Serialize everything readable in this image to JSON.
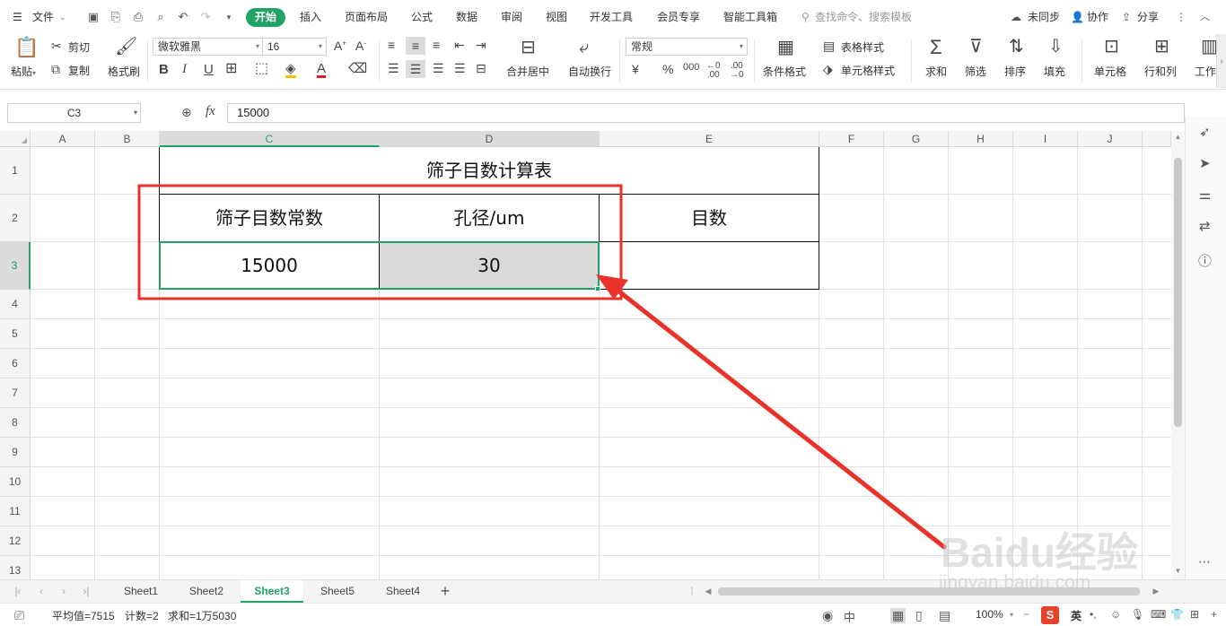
{
  "menubar": {
    "file_label": "文件",
    "tabs": [
      "开始",
      "插入",
      "页面布局",
      "公式",
      "数据",
      "审阅",
      "视图",
      "开发工具",
      "会员专享",
      "智能工具箱"
    ],
    "search_placeholder": "查找命令、搜索模板",
    "sync_label": "未同步",
    "collab_label": "协作",
    "share_label": "分享"
  },
  "ribbon": {
    "paste": "粘贴",
    "cut": "剪切",
    "copy": "复制",
    "format_painter": "格式刷",
    "font_name": "微软雅黑",
    "font_size": "16",
    "merge_center": "合并居中",
    "wrap_text": "自动换行",
    "number_format": "常规",
    "conditional_format": "条件格式",
    "table_style": "表格样式",
    "cell_style": "单元格样式",
    "sum": "求和",
    "filter": "筛选",
    "sort": "排序",
    "fill": "填充",
    "cells": "单元格",
    "rows_cols": "行和列",
    "worksheet": "工作"
  },
  "formula_bar": {
    "name_box": "C3",
    "fx_label": "fx",
    "value": "15000"
  },
  "grid": {
    "columns": [
      "A",
      "B",
      "C",
      "D",
      "E",
      "F",
      "G",
      "H",
      "I",
      "J"
    ],
    "rows": [
      "1",
      "2",
      "3",
      "4",
      "5",
      "6",
      "7",
      "8",
      "9",
      "10",
      "11",
      "12",
      "13"
    ],
    "selected_col": "C",
    "selected_row": "3",
    "table": {
      "title": "筛子目数计算表",
      "header_c": "筛子目数常数",
      "header_d": "孔径/um",
      "header_e": "目数",
      "value_c": "15000",
      "value_d": "30",
      "value_e": ""
    }
  },
  "sheet_tabs": {
    "tabs": [
      "Sheet1",
      "Sheet2",
      "Sheet3",
      "Sheet5",
      "Sheet4"
    ],
    "active": "Sheet3",
    "add_label": "+"
  },
  "status_bar": {
    "average": "平均值=7515",
    "count": "计数=2",
    "sum": "求和=1万5030",
    "zoom": "100%",
    "ime_label": "英"
  },
  "watermark": {
    "line1": "Baidu经验",
    "line2": "jingyan.baidu.com"
  },
  "colors": {
    "accent": "#21a366",
    "annotation_red": "#e8322a",
    "selected_fill": "#d9d9d9"
  }
}
